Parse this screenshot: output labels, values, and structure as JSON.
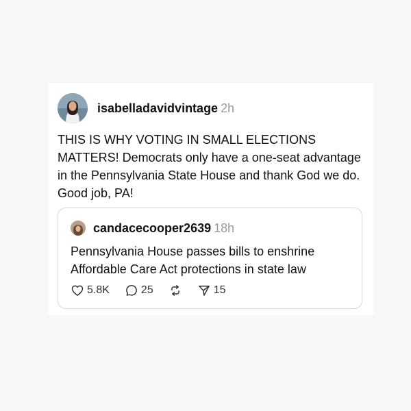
{
  "post": {
    "username": "isabelladavidvintage",
    "time": "2h",
    "text": "THIS IS WHY VOTING IN SMALL ELECTIONS MATTERS! Democrats only have a one-seat advantage in the Pennsylvania State House and thank God we do. Good job, PA!",
    "avatar_icon": "profile-photo"
  },
  "quoted": {
    "username": "candacecooper2639",
    "time": "18h",
    "text": "Pennsylvania House passes bills to enshrine Affordable Care Act protections in state law",
    "avatar_icon": "profile-photo",
    "likes": "5.8K",
    "replies": "25",
    "shares": "15"
  },
  "icons": {
    "like": "heart-icon",
    "reply": "comment-bubble-icon",
    "repost": "repost-icon",
    "share": "send-icon"
  },
  "colors": {
    "background": "#f7f7f7",
    "card": "#ffffff",
    "muted_text": "#9a9a9a",
    "border": "#d8d8d8"
  }
}
